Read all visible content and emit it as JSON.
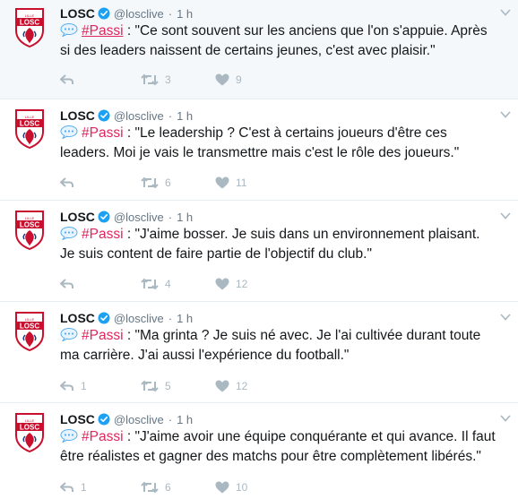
{
  "colors": {
    "hashtag": "#e0245e",
    "icon_gray": "#aab8c2",
    "verified_blue": "#1da1f2",
    "separator": "#e6ecf0",
    "first_row_bg": "#f5f8fa"
  },
  "icons": {
    "avatar": "losc-crest-icon",
    "verified": "verified-badge-icon",
    "caret": "chevron-down-icon",
    "speech": "speech-balloon-icon",
    "reply": "reply-icon",
    "retweet": "retweet-icon",
    "like": "heart-icon"
  },
  "tweets": [
    {
      "name": "LOSC",
      "handle": "@losclive",
      "dot": "·",
      "time": "1 h",
      "hashtag": "#Passi",
      "line1": " : \"Ce sont souvent sur les anciens que l'on s'appuie. Après",
      "line2": "si des leaders naissent de certains jeunes, c'est avec plaisir.\"",
      "replies": "",
      "retweets": "3",
      "likes": "9"
    },
    {
      "name": "LOSC",
      "handle": "@losclive",
      "dot": "·",
      "time": "1 h",
      "hashtag": "#Passi",
      "line1": " : \"Le leadership ? C'est à certains joueurs d'être ces",
      "line2": "leaders. Moi je vais le transmettre mais c'est le rôle des joueurs.\"",
      "replies": "",
      "retweets": "6",
      "likes": "11"
    },
    {
      "name": "LOSC",
      "handle": "@losclive",
      "dot": "·",
      "time": "1 h",
      "hashtag": "#Passi",
      "line1": " : \"J'aime bosser. Je suis dans un environnement plaisant.",
      "line2": "Je suis content de faire partie de l'objectif du club.\"",
      "replies": "",
      "retweets": "4",
      "likes": "12"
    },
    {
      "name": "LOSC",
      "handle": "@losclive",
      "dot": "·",
      "time": "1 h",
      "hashtag": "#Passi",
      "line1": " : \"Ma grinta ? Je suis né avec. Je l'ai cultivée durant toute",
      "line2": "ma carrière. J'ai aussi l'expérience du football.\"",
      "replies": "1",
      "retweets": "5",
      "likes": "12"
    },
    {
      "name": "LOSC",
      "handle": "@losclive",
      "dot": "·",
      "time": "1 h",
      "hashtag": "#Passi",
      "line1": " : \"J'aime avoir une équipe conquérante et qui avance. Il faut",
      "line2": "être réalistes et gagner des matchs pour être complètement libérés.\"",
      "replies": "1",
      "retweets": "6",
      "likes": "10"
    }
  ]
}
